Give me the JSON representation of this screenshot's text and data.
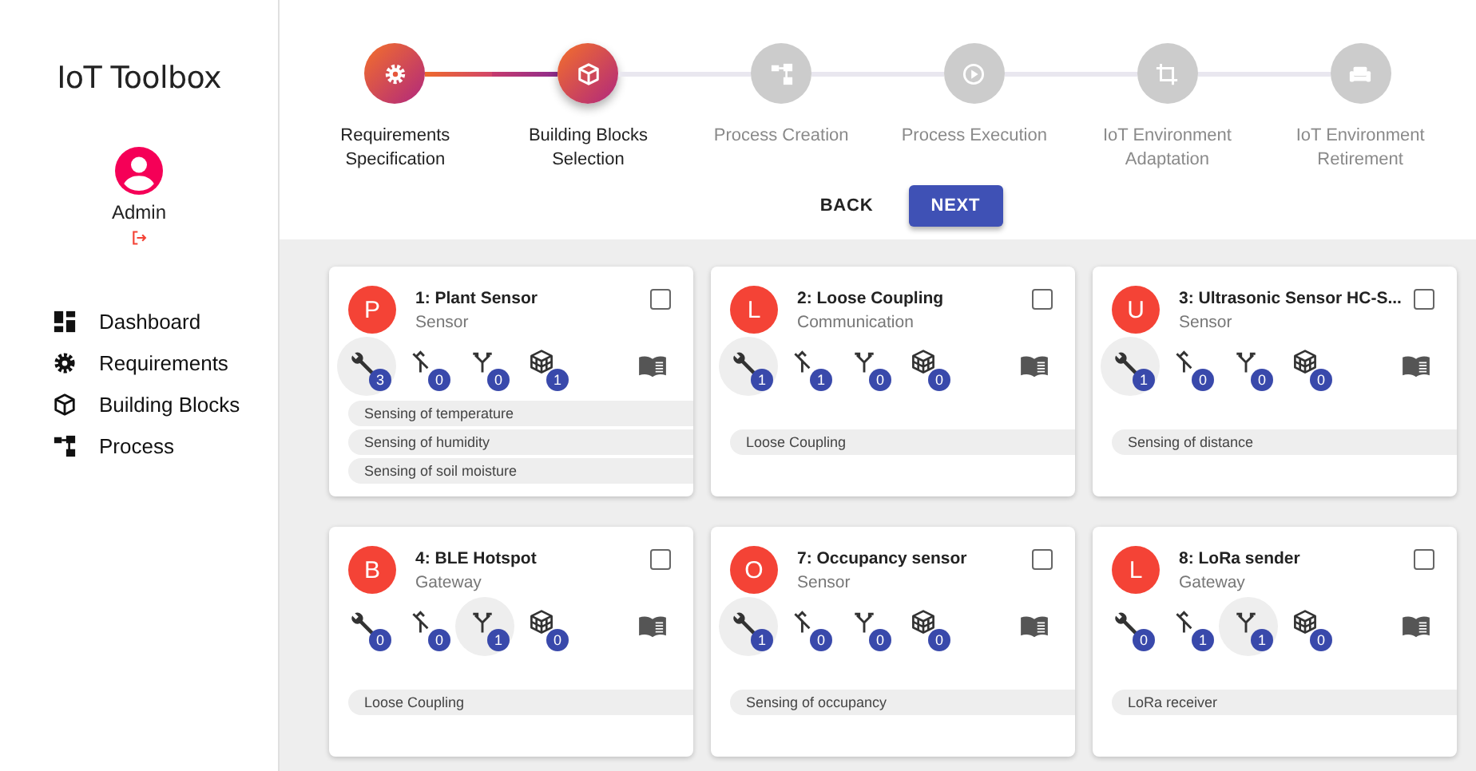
{
  "sidebar": {
    "title": "IoT Toolbox",
    "user": "Admin",
    "nav": [
      {
        "label": "Dashboard"
      },
      {
        "label": "Requirements"
      },
      {
        "label": "Building Blocks"
      },
      {
        "label": "Process"
      }
    ]
  },
  "stepper": {
    "steps": [
      {
        "label": "Requirements Specification",
        "reached": true,
        "selected": false
      },
      {
        "label": "Building Blocks Selection",
        "reached": true,
        "selected": true
      },
      {
        "label": "Process Creation",
        "reached": false,
        "selected": false
      },
      {
        "label": "Process Execution",
        "reached": false,
        "selected": false
      },
      {
        "label": "IoT Environment Adaptation",
        "reached": false,
        "selected": false
      },
      {
        "label": "IoT Environment Retirement",
        "reached": false,
        "selected": false
      }
    ],
    "buttons": [
      {
        "label": "BACK",
        "kind": "text"
      },
      {
        "label": "NEXT",
        "kind": "primary"
      }
    ]
  },
  "cards": [
    {
      "letter": "P",
      "title": "1: Plant Sensor",
      "subtitle": "Sensor",
      "checked": false,
      "stats": [
        {
          "count": "3",
          "highlighted": true
        },
        {
          "count": "0",
          "highlighted": false
        },
        {
          "count": "0",
          "highlighted": false
        },
        {
          "count": "1",
          "highlighted": false
        }
      ],
      "tags": [
        "Sensing of temperature",
        "Sensing of humidity",
        "Sensing of soil moisture"
      ]
    },
    {
      "letter": "L",
      "title": "2: Loose Coupling",
      "subtitle": "Communication",
      "checked": false,
      "stats": [
        {
          "count": "1",
          "highlighted": true
        },
        {
          "count": "1",
          "highlighted": false
        },
        {
          "count": "0",
          "highlighted": false
        },
        {
          "count": "0",
          "highlighted": false
        }
      ],
      "tags": [
        "Loose Coupling"
      ]
    },
    {
      "letter": "U",
      "title": "3: Ultrasonic Sensor HC-S...",
      "subtitle": "Sensor",
      "checked": false,
      "stats": [
        {
          "count": "1",
          "highlighted": true
        },
        {
          "count": "0",
          "highlighted": false
        },
        {
          "count": "0",
          "highlighted": false
        },
        {
          "count": "0",
          "highlighted": false
        }
      ],
      "tags": [
        "Sensing of distance"
      ]
    },
    {
      "letter": "B",
      "title": "4: BLE Hotspot",
      "subtitle": "Gateway",
      "checked": false,
      "stats": [
        {
          "count": "0",
          "highlighted": false
        },
        {
          "count": "0",
          "highlighted": false
        },
        {
          "count": "1",
          "highlighted": true
        },
        {
          "count": "0",
          "highlighted": false
        }
      ],
      "tags": [
        "Loose Coupling"
      ]
    },
    {
      "letter": "O",
      "title": "7: Occupancy sensor",
      "subtitle": "Sensor",
      "checked": false,
      "stats": [
        {
          "count": "1",
          "highlighted": true
        },
        {
          "count": "0",
          "highlighted": false
        },
        {
          "count": "0",
          "highlighted": false
        },
        {
          "count": "0",
          "highlighted": false
        }
      ],
      "tags": [
        "Sensing of occupancy"
      ]
    },
    {
      "letter": "L",
      "title": "8: LoRa sender",
      "subtitle": "Gateway",
      "checked": false,
      "stats": [
        {
          "count": "0",
          "highlighted": false
        },
        {
          "count": "1",
          "highlighted": false
        },
        {
          "count": "1",
          "highlighted": true
        },
        {
          "count": "0",
          "highlighted": false
        }
      ],
      "tags": [
        "LoRa receiver"
      ]
    }
  ]
}
